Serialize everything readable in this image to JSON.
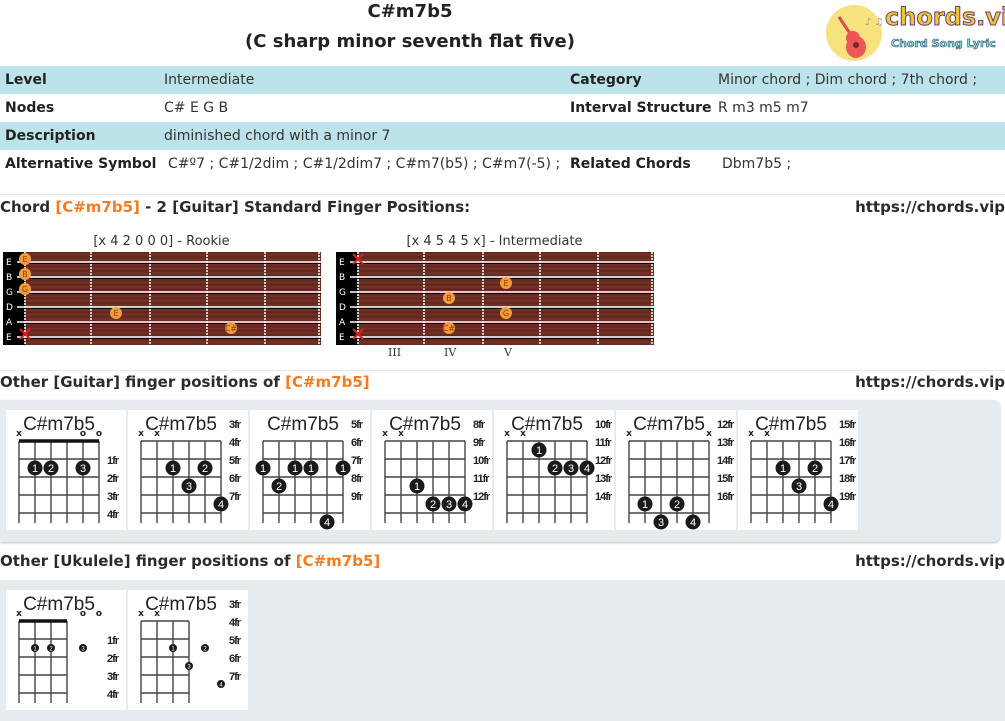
{
  "header": {
    "chord_name": "C#m7b5",
    "full_name": "(C sharp minor seventh flat five)",
    "logo": {
      "brand": "chords.vip",
      "tagline": "Chord Song Lyric",
      "icon": "guitar-icon"
    }
  },
  "info": {
    "level_label": "Level",
    "level_value": "Intermediate",
    "category_label": "Category",
    "category_value": "Minor chord ; Dim chord ; 7th chord ;",
    "nodes_label": "Nodes",
    "nodes_value": "C# E G B",
    "interval_label": "Interval Structure",
    "interval_value": "R m3 m5 m7",
    "description_label": "Description",
    "description_value": "diminished chord with a minor 7",
    "alt_label": "Alternative Symbol",
    "alt_value": "C#º7 ; C#1/2dim ; C#1/2dim7 ; C#m7(b5) ; C#m7(-5) ;",
    "related_label": "Related Chords",
    "related_value": "Dbm7b5 ;"
  },
  "standard": {
    "heading_pre": "Chord ",
    "heading_chord": "[C#m7b5]",
    "heading_post": " - 2 [Guitar] Standard Finger Positions:",
    "site": "https://chords.vip",
    "string_names": [
      "E",
      "B",
      "G",
      "D",
      "A",
      "E"
    ],
    "fretboards": [
      {
        "title": "[x 4 2 0 0 0] - Rookie",
        "notes": [
          {
            "string": 0,
            "fret": 0,
            "label": "E"
          },
          {
            "string": 1,
            "fret": 0,
            "label": "B"
          },
          {
            "string": 2,
            "fret": 0,
            "label": "G"
          },
          {
            "string": 3,
            "fret": 2,
            "label": "E"
          },
          {
            "string": 4,
            "fret": 4,
            "label": "C#"
          }
        ],
        "muted": [
          5
        ],
        "roman": []
      },
      {
        "title": "[x 4 5 4 5 x] - Intermediate",
        "notes": [
          {
            "string": 1,
            "fret": 5,
            "label": "E"
          },
          {
            "string": 2,
            "fret": 4,
            "label": "B"
          },
          {
            "string": 3,
            "fret": 5,
            "label": "G"
          },
          {
            "string": 4,
            "fret": 4,
            "label": "C#"
          }
        ],
        "muted": [
          0,
          5
        ],
        "roman": [
          "III",
          "IV",
          "V"
        ]
      }
    ]
  },
  "guitar_other": {
    "heading_pre": "Other [Guitar] finger positions of ",
    "heading_chord": "[C#m7b5]",
    "site": "https://chords.vip",
    "diagrams": [
      {
        "name": "C#m7b5",
        "top": [
          "x",
          "",
          "",
          "",
          "o",
          "o"
        ],
        "nut": true,
        "frets": [
          "1fr",
          "2fr",
          "3fr",
          "4fr"
        ],
        "dots": [
          {
            "s": 1,
            "r": 1,
            "f": "1"
          },
          {
            "s": 2,
            "r": 1,
            "f": "2"
          },
          {
            "s": 4,
            "r": 1,
            "f": "3"
          }
        ]
      },
      {
        "name": "C#m7b5",
        "top": [
          "x",
          "x",
          "",
          "",
          "",
          ""
        ],
        "nut": false,
        "frets": [
          "3fr",
          "4fr",
          "5fr",
          "6fr",
          "7fr"
        ],
        "dots": [
          {
            "s": 2,
            "r": 1,
            "f": "1"
          },
          {
            "s": 4,
            "r": 1,
            "f": "2"
          },
          {
            "s": 3,
            "r": 2,
            "f": "3"
          },
          {
            "s": 5,
            "r": 3,
            "f": "4"
          }
        ]
      },
      {
        "name": "C#m7b5",
        "top": [
          "",
          "",
          "",
          "",
          "",
          ""
        ],
        "nut": false,
        "frets": [
          "5fr",
          "6fr",
          "7fr",
          "8fr",
          "9fr"
        ],
        "dots": [
          {
            "s": 0,
            "r": 1,
            "f": "1"
          },
          {
            "s": 2,
            "r": 1,
            "f": "1"
          },
          {
            "s": 3,
            "r": 1,
            "f": "1"
          },
          {
            "s": 5,
            "r": 1,
            "f": "1"
          },
          {
            "s": 1,
            "r": 2,
            "f": "2"
          },
          {
            "s": 4,
            "r": 4,
            "f": "4"
          }
        ]
      },
      {
        "name": "C#m7b5",
        "top": [
          "x",
          "x",
          "",
          "",
          "",
          ""
        ],
        "nut": false,
        "frets": [
          "8fr",
          "9fr",
          "10fr",
          "11fr",
          "12fr"
        ],
        "dots": [
          {
            "s": 2,
            "r": 2,
            "f": "1"
          },
          {
            "s": 3,
            "r": 3,
            "f": "2"
          },
          {
            "s": 4,
            "r": 3,
            "f": "3"
          },
          {
            "s": 5,
            "r": 3,
            "f": "4"
          }
        ]
      },
      {
        "name": "C#m7b5",
        "top": [
          "x",
          "x",
          "",
          "",
          "",
          ""
        ],
        "nut": false,
        "frets": [
          "10fr",
          "11fr",
          "12fr",
          "13fr",
          "14fr"
        ],
        "dots": [
          {
            "s": 2,
            "r": 0,
            "f": "1"
          },
          {
            "s": 3,
            "r": 1,
            "f": "2"
          },
          {
            "s": 4,
            "r": 1,
            "f": "3"
          },
          {
            "s": 5,
            "r": 1,
            "f": "4"
          }
        ]
      },
      {
        "name": "C#m7b5",
        "top": [
          "x",
          "",
          "",
          "",
          "",
          "x"
        ],
        "nut": false,
        "frets": [
          "12fr",
          "13fr",
          "14fr",
          "15fr",
          "16fr"
        ],
        "dots": [
          {
            "s": 1,
            "r": 3,
            "f": "1"
          },
          {
            "s": 3,
            "r": 3,
            "f": "2"
          },
          {
            "s": 2,
            "r": 4,
            "f": "3"
          },
          {
            "s": 4,
            "r": 4,
            "f": "4"
          }
        ]
      },
      {
        "name": "C#m7b5",
        "top": [
          "x",
          "x",
          "",
          "",
          "",
          ""
        ],
        "nut": false,
        "frets": [
          "15fr",
          "16fr",
          "17fr",
          "18fr",
          "19fr"
        ],
        "dots": [
          {
            "s": 2,
            "r": 1,
            "f": "1"
          },
          {
            "s": 4,
            "r": 1,
            "f": "2"
          },
          {
            "s": 3,
            "r": 2,
            "f": "3"
          },
          {
            "s": 5,
            "r": 3,
            "f": "4"
          }
        ]
      }
    ]
  },
  "ukulele_other": {
    "heading_pre": "Other [Ukulele] finger positions of ",
    "heading_chord": "[C#m7b5]",
    "site": "https://chords.vip",
    "diagrams": [
      {
        "name": "C#m7b5",
        "top": [
          "x",
          "",
          "",
          "",
          "o",
          "o"
        ],
        "nut": true,
        "frets": [
          "1fr",
          "2fr",
          "3fr",
          "4fr"
        ],
        "dots": [
          {
            "s": 1,
            "r": 1,
            "f": "1"
          },
          {
            "s": 2,
            "r": 1,
            "f": "2"
          },
          {
            "s": 4,
            "r": 1,
            "f": "3"
          }
        ]
      },
      {
        "name": "C#m7b5",
        "top": [
          "x",
          "x",
          "",
          "",
          "",
          ""
        ],
        "nut": false,
        "frets": [
          "3fr",
          "4fr",
          "5fr",
          "6fr",
          "7fr"
        ],
        "dots": [
          {
            "s": 2,
            "r": 1,
            "f": "1"
          },
          {
            "s": 4,
            "r": 1,
            "f": "2"
          },
          {
            "s": 3,
            "r": 2,
            "f": "3"
          },
          {
            "s": 5,
            "r": 3,
            "f": "4"
          }
        ]
      }
    ]
  }
}
